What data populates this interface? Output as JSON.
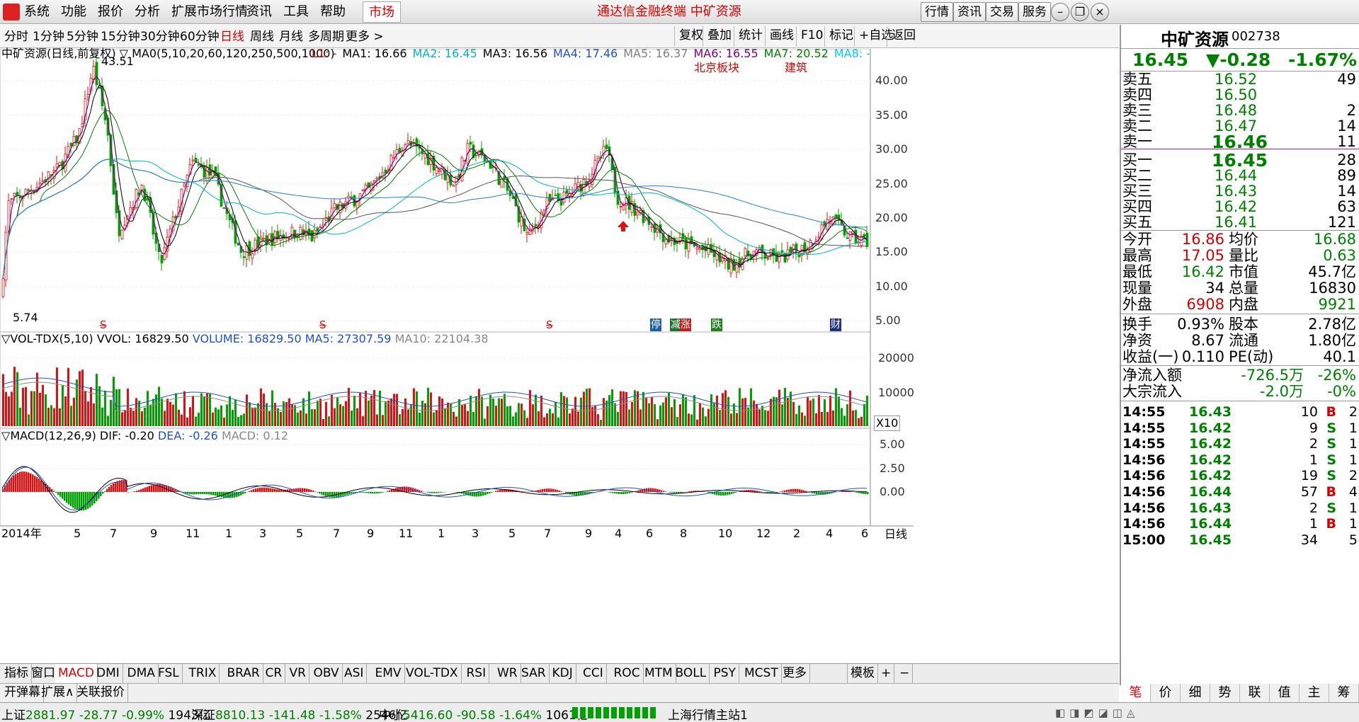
{
  "menu": {
    "items": [
      "系统",
      "功能",
      "报价",
      "分析",
      "扩展市场行情",
      "资讯",
      "工具",
      "帮助"
    ],
    "market": "市场",
    "title": "通达信金融终端 中矿资源",
    "right_buttons": [
      "行情",
      "资讯",
      "交易",
      "服务"
    ]
  },
  "periods": {
    "items": [
      "分时",
      "1分钟",
      "5分钟",
      "15分钟",
      "30分钟",
      "60分钟",
      "日线",
      "周线",
      "月线",
      "多周期",
      "更多 >"
    ],
    "active": "日线",
    "tools": [
      "复权",
      "叠加",
      "统计",
      "画线",
      "F10",
      "标记",
      "+自选",
      "返回"
    ]
  },
  "main_chart": {
    "header_name": "中矿资源(日线,前复权)",
    "ma_label": "MA0(5,10,20,60,120,250,500,1000)",
    "ma_values": [
      {
        "text": "L1: -",
        "color": "#cc0000"
      },
      {
        "text": "MA1: 16.66",
        "color": "#000000"
      },
      {
        "text": "MA2: 16.45",
        "color": "#00b5c8"
      },
      {
        "text": "MA3: 16.56",
        "color": "#000000"
      },
      {
        "text": "MA4: 17.46",
        "color": "#2050d0"
      },
      {
        "text": "MA5: 16.37",
        "color": "#808080"
      },
      {
        "text": "MA6: 16.55",
        "color": "#800080"
      },
      {
        "text": "MA7: 20.52",
        "color": "#008000"
      },
      {
        "text": "MA8: -",
        "color": "#00c8ff"
      }
    ],
    "tags": [
      "北京板块",
      "建筑"
    ],
    "high_label": "43.51",
    "low_label": "5.74",
    "y_ticks": [
      "40.00",
      "35.00",
      "30.00",
      "25.00",
      "20.00",
      "15.00",
      "10.00",
      "5.00"
    ],
    "markers": [
      "停",
      "减",
      "涨",
      "跌",
      "财"
    ]
  },
  "volume_chart": {
    "label": "VOL-TDX(5,10)",
    "vvol": "VVOL: 16829.50",
    "volume": "VOLUME: 16829.50",
    "ma5": "MA5: 27307.59",
    "ma10": "MA10: 22104.38",
    "y_ticks": [
      "20000",
      "10000"
    ],
    "unit": "X10"
  },
  "macd_chart": {
    "label": "MACD(12,26,9)",
    "dif": "DIF: -0.20",
    "dea": "DEA: -0.26",
    "macd": "MACD: 0.12",
    "y_ticks": [
      "5.00",
      "2.50",
      "0.00"
    ]
  },
  "x_axis": {
    "labels": [
      "2014年",
      "5",
      "7",
      "9",
      "11",
      "1",
      "3",
      "5",
      "7",
      "9",
      "11",
      "1",
      "3",
      "5",
      "7",
      "9",
      "4",
      "6",
      "8",
      "10",
      "12",
      "2",
      "4",
      "6"
    ],
    "period": "日线"
  },
  "indicator_tabs": [
    "指标",
    "窗口",
    "MACD",
    "DMI",
    "DMA",
    "FSL",
    "TRIX",
    "BRAR",
    "CR",
    "VR",
    "OBV",
    "ASI",
    "EMV",
    "VOL-TDX",
    "RSI",
    "WR",
    "SAR",
    "KDJ",
    "CCI",
    "ROC",
    "MTM",
    "BOLL",
    "PSY",
    "MCST",
    "更多"
  ],
  "indicator_active": "MACD",
  "template_label": "模板",
  "sub_bar": [
    "开弹幕",
    "扩展∧",
    "关联报价"
  ],
  "quote": {
    "name": "中矿资源",
    "code": "002738",
    "price": "16.45",
    "change": "▼-0.28",
    "pct": "-1.67%",
    "asks": [
      {
        "label": "卖五",
        "price": "16.52",
        "vol": "49"
      },
      {
        "label": "卖四",
        "price": "16.50",
        "vol": ""
      },
      {
        "label": "卖三",
        "price": "16.48",
        "vol": "2"
      },
      {
        "label": "卖二",
        "price": "16.47",
        "vol": "14"
      },
      {
        "label": "卖一",
        "price": "16.46",
        "vol": "11"
      }
    ],
    "bids": [
      {
        "label": "买一",
        "price": "16.45",
        "vol": "28"
      },
      {
        "label": "买二",
        "price": "16.44",
        "vol": "89"
      },
      {
        "label": "买三",
        "price": "16.43",
        "vol": "14"
      },
      {
        "label": "买四",
        "price": "16.42",
        "vol": "63"
      },
      {
        "label": "买五",
        "price": "16.41",
        "vol": "121"
      }
    ],
    "stats": [
      {
        "l1": "今开",
        "v1": "16.86",
        "c1": "red",
        "l2": "均价",
        "v2": "16.68",
        "c2": "green"
      },
      {
        "l1": "最高",
        "v1": "17.05",
        "c1": "red",
        "l2": "量比",
        "v2": "0.63",
        "c2": "green"
      },
      {
        "l1": "最低",
        "v1": "16.42",
        "c1": "green",
        "l2": "市值",
        "v2": "45.7亿",
        "c2": "black"
      },
      {
        "l1": "现量",
        "v1": "34",
        "c1": "black",
        "l2": "总量",
        "v2": "16830",
        "c2": "black"
      },
      {
        "l1": "外盘",
        "v1": "6908",
        "c1": "red",
        "l2": "内盘",
        "v2": "9921",
        "c2": "green"
      }
    ],
    "fundamentals": [
      {
        "l1": "换手",
        "v1": "0.93%",
        "l2": "股本",
        "v2": "2.78亿"
      },
      {
        "l1": "净资",
        "v1": "8.67",
        "l2": "流通",
        "v2": "1.80亿"
      },
      {
        "l1": "收益(一)",
        "v1": "0.110",
        "l2": "PE(动)",
        "v2": "40.1"
      }
    ],
    "flows": [
      {
        "label": "净流入额",
        "value": "-726.5万",
        "pct": "-26%"
      },
      {
        "label": "大宗流入",
        "value": "-2.0万",
        "pct": "-0%"
      }
    ],
    "ticks": [
      {
        "time": "14:55",
        "price": "16.43",
        "vol": "10",
        "side": "B",
        "n": "2"
      },
      {
        "time": "14:55",
        "price": "16.42",
        "vol": "9",
        "side": "S",
        "n": "1"
      },
      {
        "time": "14:55",
        "price": "16.42",
        "vol": "2",
        "side": "S",
        "n": "1"
      },
      {
        "time": "14:56",
        "price": "16.42",
        "vol": "1",
        "side": "S",
        "n": "1"
      },
      {
        "time": "14:56",
        "price": "16.42",
        "vol": "19",
        "side": "S",
        "n": "2"
      },
      {
        "time": "14:56",
        "price": "16.44",
        "vol": "57",
        "side": "B",
        "n": "4"
      },
      {
        "time": "14:56",
        "price": "16.43",
        "vol": "2",
        "side": "S",
        "n": "1"
      },
      {
        "time": "14:56",
        "price": "16.44",
        "vol": "1",
        "side": "B",
        "n": "1"
      },
      {
        "time": "15:00",
        "price": "16.45",
        "vol": "34",
        "side": "",
        "n": "5"
      }
    ],
    "tabs": [
      "笔",
      "价",
      "细",
      "势",
      "联",
      "值",
      "主",
      "筹"
    ]
  },
  "status": {
    "sh_label": "上证",
    "sh_val": "2881.97",
    "sh_chg": "-28.77",
    "sh_pct": "-0.99%",
    "sh_amt": "1943亿",
    "sz_label": "深证",
    "sz_val": "8810.13",
    "sz_chg": "-141.48",
    "sz_pct": "-1.58%",
    "sz_amt": "2546亿",
    "zx_label": "中小",
    "zx_val": "5416.60",
    "zx_chg": "-90.58",
    "zx_pct": "-1.64%",
    "zx_amt": "1061亿",
    "server": "上海行情主站1"
  },
  "colors": {
    "up": "#e01010",
    "down": "#00a000",
    "accent": "#d00000"
  }
}
